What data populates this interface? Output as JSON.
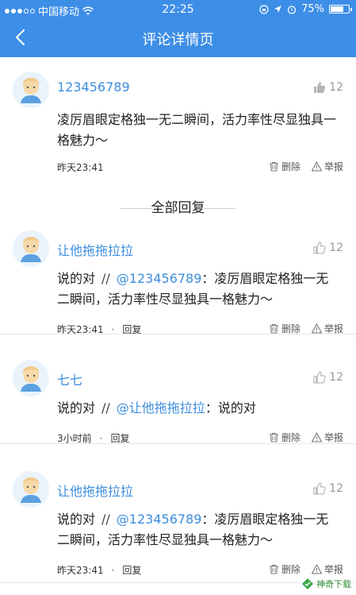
{
  "status_bar": {
    "carrier": "中国移动",
    "time": "22:25",
    "battery": "75%",
    "battery_level": 0.75
  },
  "nav": {
    "title": "评论详情页",
    "back_icon": "chevron-left-icon"
  },
  "main_comment": {
    "username": "123456789",
    "likes": "12",
    "content": "凌厉眉眼定格独一无二瞬间，活力率性尽显独具一格魅力～",
    "time": "昨天23:41",
    "delete_label": "删除",
    "report_label": "举报"
  },
  "section_title": "全部回复",
  "replies": [
    {
      "username": "让他拖拖拉拉",
      "likes": "12",
      "prefix": "说的对",
      "slash": "//",
      "mention": "@123456789",
      "text": "：凌厉眉眼定格独一无二瞬间，活力率性尽显独具一格魅力～",
      "time": "昨天23:41",
      "dot": "·",
      "reply_label": "回复",
      "delete_label": "删除",
      "report_label": "举报"
    },
    {
      "username": "七七",
      "likes": "12",
      "prefix": "说的对",
      "slash": "//",
      "mention": "@让他拖拖拉拉",
      "text": "：说的对",
      "time": "3小时前",
      "dot": "·",
      "reply_label": "回复",
      "delete_label": "删除",
      "report_label": "举报"
    },
    {
      "username": "让他拖拖拉拉",
      "likes": "12",
      "prefix": "说的对",
      "slash": "//",
      "mention": "@123456789",
      "text": "：凌厉眉眼定格独一无二瞬间，活力率性尽显独具一格魅力～",
      "time": "昨天23:41",
      "dot": "·",
      "reply_label": "回复",
      "delete_label": "删除",
      "report_label": "举报"
    }
  ],
  "watermark": "神奇下载",
  "colors": {
    "accent": "#3d8ee6",
    "username": "#3c8ddc"
  }
}
